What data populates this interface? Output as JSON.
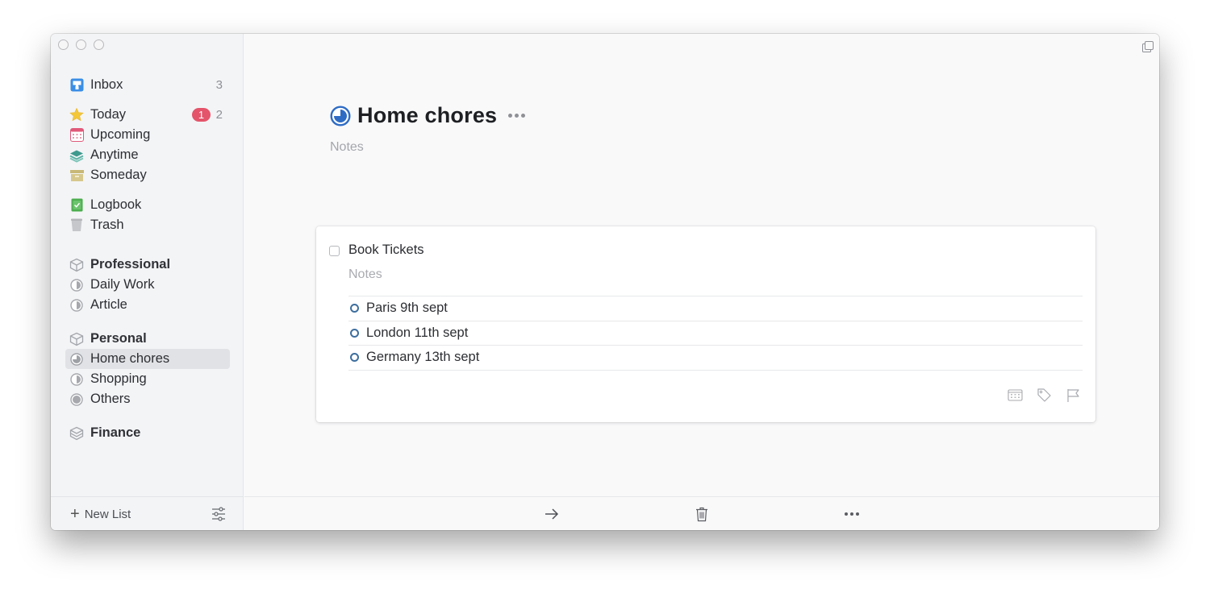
{
  "window": {
    "traffic_lights": [
      "close",
      "minimize",
      "zoom"
    ]
  },
  "sidebar": {
    "inbox": {
      "label": "Inbox",
      "count": "3",
      "icon": "inbox-icon"
    },
    "today": {
      "label": "Today",
      "badge": "1",
      "count": "2",
      "icon": "star-icon"
    },
    "upcoming": {
      "label": "Upcoming",
      "icon": "calendar-icon"
    },
    "anytime": {
      "label": "Anytime",
      "icon": "layers-icon"
    },
    "someday": {
      "label": "Someday",
      "icon": "archive-box-icon"
    },
    "logbook": {
      "label": "Logbook",
      "icon": "logbook-check-icon"
    },
    "trash": {
      "label": "Trash",
      "icon": "trash-icon"
    },
    "areas": [
      {
        "label": "Professional",
        "icon": "area-cube-icon",
        "projects": [
          {
            "label": "Daily Work",
            "icon": "project-half-pie-icon"
          },
          {
            "label": "Article",
            "icon": "project-half-pie-icon"
          }
        ]
      },
      {
        "label": "Personal",
        "icon": "area-cube-icon",
        "projects": [
          {
            "label": "Home chores",
            "icon": "project-pie-icon",
            "selected": true
          },
          {
            "label": "Shopping",
            "icon": "project-half-pie-icon"
          },
          {
            "label": "Others",
            "icon": "project-full-pie-icon"
          }
        ]
      },
      {
        "label": "Finance",
        "icon": "area-stack-icon",
        "projects": []
      }
    ],
    "footer": {
      "new_list_label": "New List"
    }
  },
  "main": {
    "title": "Home chores",
    "notes_placeholder": "Notes",
    "progress_fraction": 0.75,
    "task": {
      "title": "Book Tickets",
      "checked": false,
      "notes_placeholder": "Notes",
      "checklist": [
        {
          "label": "Paris 9th sept",
          "done": false
        },
        {
          "label": "London 11th sept",
          "done": false
        },
        {
          "label": "Germany 13th sept",
          "done": false
        }
      ],
      "actions": [
        "when-calendar-icon",
        "tag-icon",
        "deadline-flag-icon"
      ]
    },
    "bottom_bar": [
      "move-arrow-icon",
      "trash-icon",
      "more-icon"
    ]
  },
  "colors": {
    "accent_blue": "#2e6cc4",
    "badge_red": "#e4546a",
    "inbox_blue": "#3a8ee6",
    "star_yellow": "#f4c739",
    "upcoming_red": "#e0597a",
    "anytime_teal": "#3f9a8e",
    "someday_khaki": "#c8b877",
    "logbook_green": "#4cae4f"
  }
}
